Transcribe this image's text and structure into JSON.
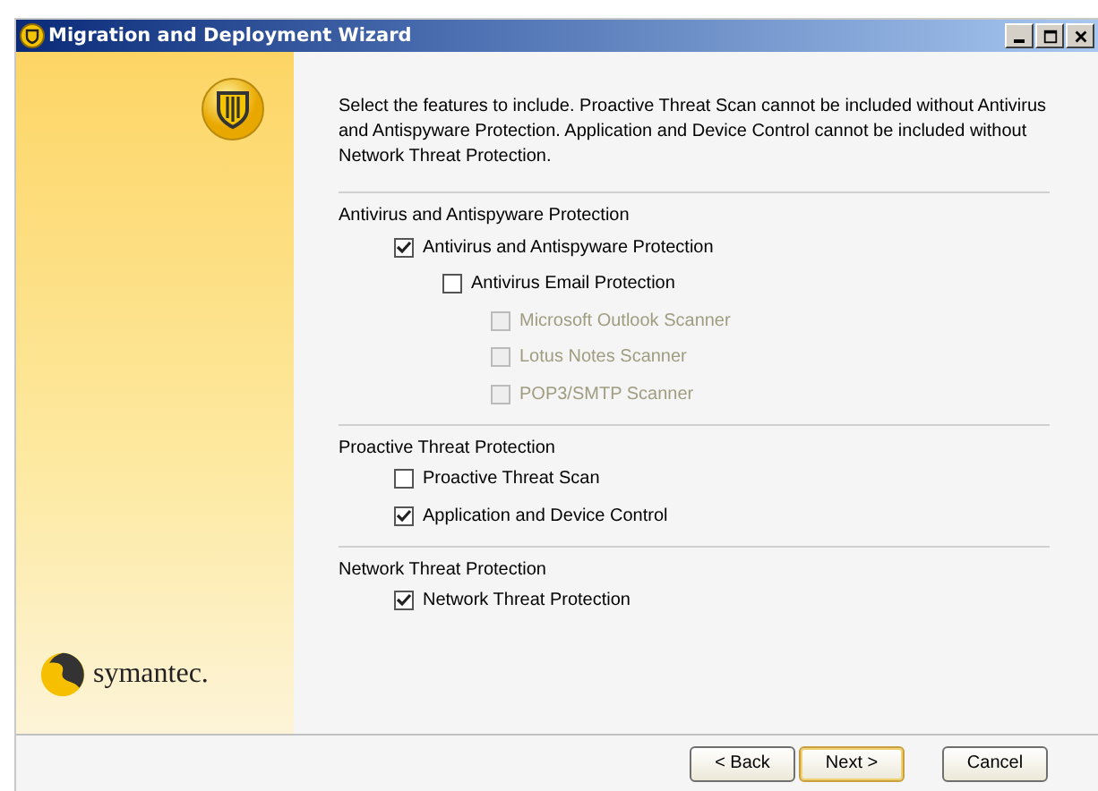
{
  "window": {
    "title": "Migration and Deployment Wizard"
  },
  "brand": {
    "name": "symantec."
  },
  "description": "Select the features to include. Proactive Threat Scan cannot be included without Antivirus and Antispyware Protection. Application and Device Control cannot be included without Network Threat Protection.",
  "groups": [
    {
      "heading": "Antivirus and Antispyware Protection",
      "items": [
        {
          "label": "Antivirus and Antispyware Protection",
          "checked": true,
          "disabled": false,
          "children": [
            {
              "label": "Antivirus Email Protection",
              "checked": false,
              "disabled": false,
              "children": [
                {
                  "label": "Microsoft Outlook Scanner",
                  "checked": false,
                  "disabled": true
                },
                {
                  "label": "Lotus Notes Scanner",
                  "checked": false,
                  "disabled": true
                },
                {
                  "label": "POP3/SMTP Scanner",
                  "checked": false,
                  "disabled": true
                }
              ]
            }
          ]
        }
      ]
    },
    {
      "heading": "Proactive Threat Protection",
      "items": [
        {
          "label": "Proactive Threat Scan",
          "checked": false,
          "disabled": false
        },
        {
          "label": "Application and Device Control",
          "checked": true,
          "disabled": false
        }
      ]
    },
    {
      "heading": "Network Threat Protection",
      "items": [
        {
          "label": "Network Threat Protection",
          "checked": true,
          "disabled": false
        }
      ]
    }
  ],
  "buttons": [
    {
      "label": "< Back",
      "default": false
    },
    {
      "label": "Next >",
      "default": true
    },
    {
      "label": "Cancel",
      "default": false
    }
  ]
}
